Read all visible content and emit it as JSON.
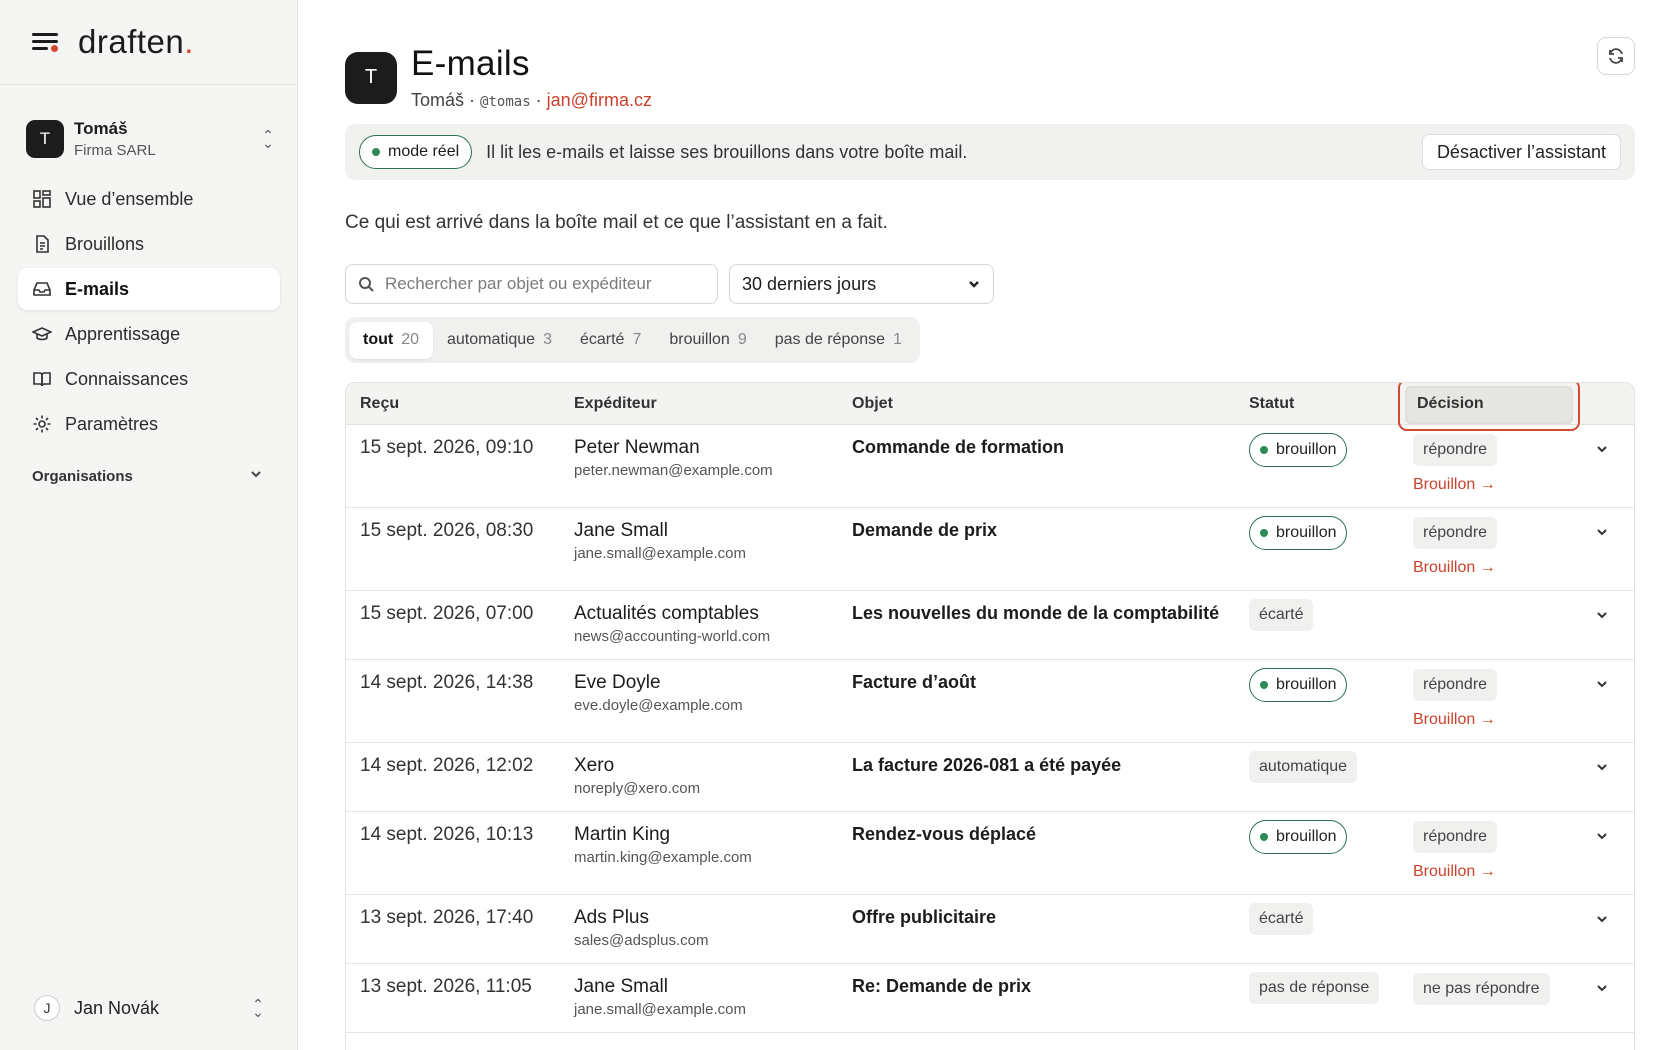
{
  "sidebar": {
    "brand": "draften",
    "account": {
      "avatar": "T",
      "name": "Tomáš",
      "org": "Firma SARL"
    },
    "nav": [
      {
        "label": "Vue d’ensemble",
        "icon": "dashboard-icon"
      },
      {
        "label": "Brouillons",
        "icon": "document-icon"
      },
      {
        "label": "E-mails",
        "icon": "inbox-icon",
        "active": true
      },
      {
        "label": "Apprentissage",
        "icon": "graduation-cap-icon"
      },
      {
        "label": "Connaissances",
        "icon": "book-icon"
      },
      {
        "label": "Paramètres",
        "icon": "gear-icon"
      }
    ],
    "organisations_label": "Organisations",
    "user": {
      "avatar": "J",
      "name": "Jan Novák"
    }
  },
  "header": {
    "avatar": "T",
    "title": "E-mails",
    "name": "Tomáš",
    "separator": "·",
    "handle": "@tomas",
    "email": "jan@firma.cz"
  },
  "banner": {
    "mode": "mode réel",
    "text": "Il lit les e-mails et laisse ses brouillons dans votre boîte mail.",
    "button": "Désactiver l’assistant"
  },
  "intro": "Ce qui est arrivé dans la boîte mail et ce que l’assistant en a fait.",
  "search": {
    "placeholder": "Rechercher par objet ou expéditeur",
    "value": ""
  },
  "period": {
    "selected": "30 derniers jours"
  },
  "filters": [
    {
      "label": "tout",
      "count": "20",
      "active": true
    },
    {
      "label": "automatique",
      "count": "3"
    },
    {
      "label": "écarté",
      "count": "7"
    },
    {
      "label": "brouillon",
      "count": "9"
    },
    {
      "label": "pas de réponse",
      "count": "1"
    }
  ],
  "table": {
    "columns": [
      "Reçu",
      "Expéditeur",
      "Objet",
      "Statut",
      "Décision"
    ],
    "rows": [
      {
        "received": "15 sept. 2026, 09:10",
        "sender": "Peter Newman",
        "email": "peter.newman@example.com",
        "subject": "Commande de formation",
        "status": "brouillon",
        "status_kind": "draft",
        "decision": "répondre",
        "link": "Brouillon →"
      },
      {
        "received": "15 sept. 2026, 08:30",
        "sender": "Jane Small",
        "email": "jane.small@example.com",
        "subject": "Demande de prix",
        "status": "brouillon",
        "status_kind": "draft",
        "decision": "répondre",
        "link": "Brouillon →"
      },
      {
        "received": "15 sept. 2026, 07:00",
        "sender": "Actualités comptables",
        "email": "news@accounting-world.com",
        "subject": "Les nouvelles du monde de la comptabilité",
        "status": "écarté",
        "status_kind": "grey",
        "decision": "",
        "link": ""
      },
      {
        "received": "14 sept. 2026, 14:38",
        "sender": "Eve Doyle",
        "email": "eve.doyle@example.com",
        "subject": "Facture d’août",
        "status": "brouillon",
        "status_kind": "draft",
        "decision": "répondre",
        "link": "Brouillon →"
      },
      {
        "received": "14 sept. 2026, 12:02",
        "sender": "Xero",
        "email": "noreply@xero.com",
        "subject": "La facture 2026-081 a été payée",
        "status": "automatique",
        "status_kind": "grey",
        "decision": "",
        "link": ""
      },
      {
        "received": "14 sept. 2026, 10:13",
        "sender": "Martin King",
        "email": "martin.king@example.com",
        "subject": "Rendez-vous déplacé",
        "status": "brouillon",
        "status_kind": "draft",
        "decision": "répondre",
        "link": "Brouillon →"
      },
      {
        "received": "13 sept. 2026, 17:40",
        "sender": "Ads Plus",
        "email": "sales@adsplus.com",
        "subject": "Offre publicitaire",
        "status": "écarté",
        "status_kind": "grey",
        "decision": "",
        "link": ""
      },
      {
        "received": "13 sept. 2026, 11:05",
        "sender": "Jane Small",
        "email": "jane.small@example.com",
        "subject": "Re: Demande de prix",
        "status": "pas de réponse",
        "status_kind": "grey",
        "decision": "ne pas répondre",
        "link": ""
      }
    ]
  },
  "colors": {
    "accent": "#c9422b",
    "green": "#2d6e4e",
    "highlight": "#d04a32"
  }
}
